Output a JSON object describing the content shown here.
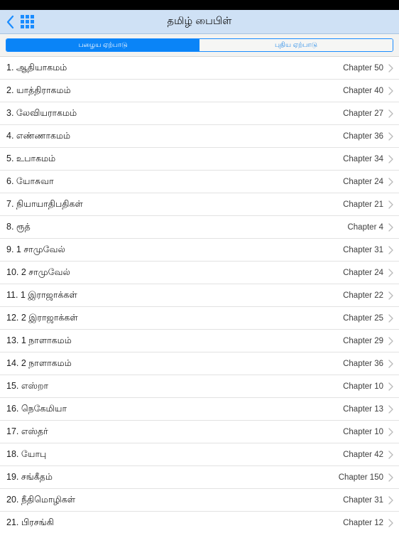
{
  "statusbar": {
    "visible": true
  },
  "header": {
    "title": "தமிழ் பைபிள்",
    "back_icon": "back-chevron-icon",
    "grid_icon": "grid-menu-icon"
  },
  "segmented_control": {
    "options": [
      {
        "label": "பழைய ஏற்பாடு",
        "selected": true
      },
      {
        "label": "புதிய ஏற்பாடு",
        "selected": false
      }
    ],
    "selected_color": "#0a84f7",
    "text_color_inactive": "#2f8fe8"
  },
  "list": {
    "chevron_icon": "disclosure-chevron-icon",
    "rows": [
      {
        "title": "1. ஆதியாகமம்",
        "chapters": "Chapter 50"
      },
      {
        "title": "2. யாத்திராகமம்",
        "chapters": "Chapter 40"
      },
      {
        "title": "3. லேவியராகமம்",
        "chapters": "Chapter 27"
      },
      {
        "title": "4. எண்ணாகமம்",
        "chapters": "Chapter 36"
      },
      {
        "title": "5. உபாகமம்",
        "chapters": "Chapter 34"
      },
      {
        "title": "6. யோசுவா",
        "chapters": "Chapter 24"
      },
      {
        "title": "7. நியாயாதிபதிகள்",
        "chapters": "Chapter 21"
      },
      {
        "title": "8. ரூத்",
        "chapters": "Chapter 4"
      },
      {
        "title": "9. 1 சாமுவேல்",
        "chapters": "Chapter 31"
      },
      {
        "title": "10. 2 சாமுவேல்",
        "chapters": "Chapter 24"
      },
      {
        "title": "11. 1 இராஜாக்கள்",
        "chapters": "Chapter 22"
      },
      {
        "title": "12. 2 இராஜாக்கள்",
        "chapters": "Chapter 25"
      },
      {
        "title": "13. 1 நாளாகமம்",
        "chapters": "Chapter 29"
      },
      {
        "title": "14. 2 நாளாகமம்",
        "chapters": "Chapter 36"
      },
      {
        "title": "15. எஸ்றா",
        "chapters": "Chapter 10"
      },
      {
        "title": "16. நெகேமியா",
        "chapters": "Chapter 13"
      },
      {
        "title": "17. எஸ்தர்",
        "chapters": "Chapter 10"
      },
      {
        "title": "18. யோபு",
        "chapters": "Chapter 42"
      },
      {
        "title": "19. சங்கீதம்",
        "chapters": "Chapter 150"
      },
      {
        "title": "20. நீதிமொழிகள்",
        "chapters": "Chapter 31"
      },
      {
        "title": "21. பிரசங்கி",
        "chapters": "Chapter 12"
      }
    ]
  }
}
